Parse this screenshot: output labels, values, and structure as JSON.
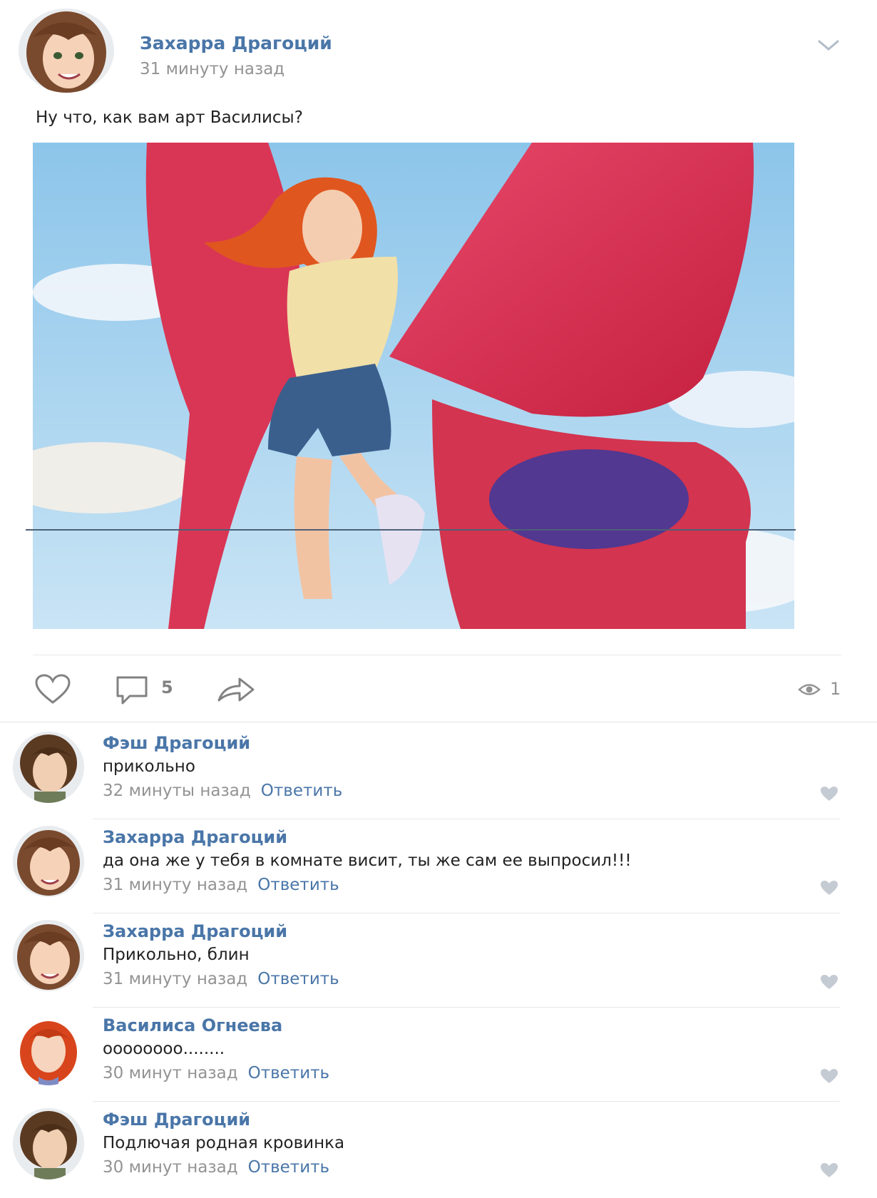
{
  "post": {
    "author": "Захарра Драгоций",
    "time": "31 минуту назад",
    "text": "Ну что, как вам арт Василисы?",
    "comment_count": "5",
    "views": "1"
  },
  "comments": [
    {
      "author": "Фэш Драгоций",
      "text": "прикольно",
      "time": "32 минуты назад",
      "reply": "Ответить"
    },
    {
      "author": "Захарра Драгоций",
      "text": "да она же у тебя в комнате висит, ты же сам ее выпросил!!!",
      "time": "31 минуту назад",
      "reply": "Ответить"
    },
    {
      "author": "Захарра Драгоций",
      "text": "Прикольно, блин",
      "time": "31 минуту назад",
      "reply": "Ответить"
    },
    {
      "author": "Василиса Огнеева",
      "text": "оооооооо........",
      "time": "30 минут назад",
      "reply": "Ответить"
    },
    {
      "author": "Фэш Драгоций",
      "text": "Подлючая родная кровинка",
      "time": "30 минут назад",
      "reply": "Ответить"
    }
  ],
  "colors": {
    "link": "#4a76a8",
    "muted": "#939393",
    "icon": "#828282"
  },
  "icons": [
    "chevron-down-icon",
    "heart-icon",
    "comment-icon",
    "share-icon",
    "eye-icon"
  ]
}
